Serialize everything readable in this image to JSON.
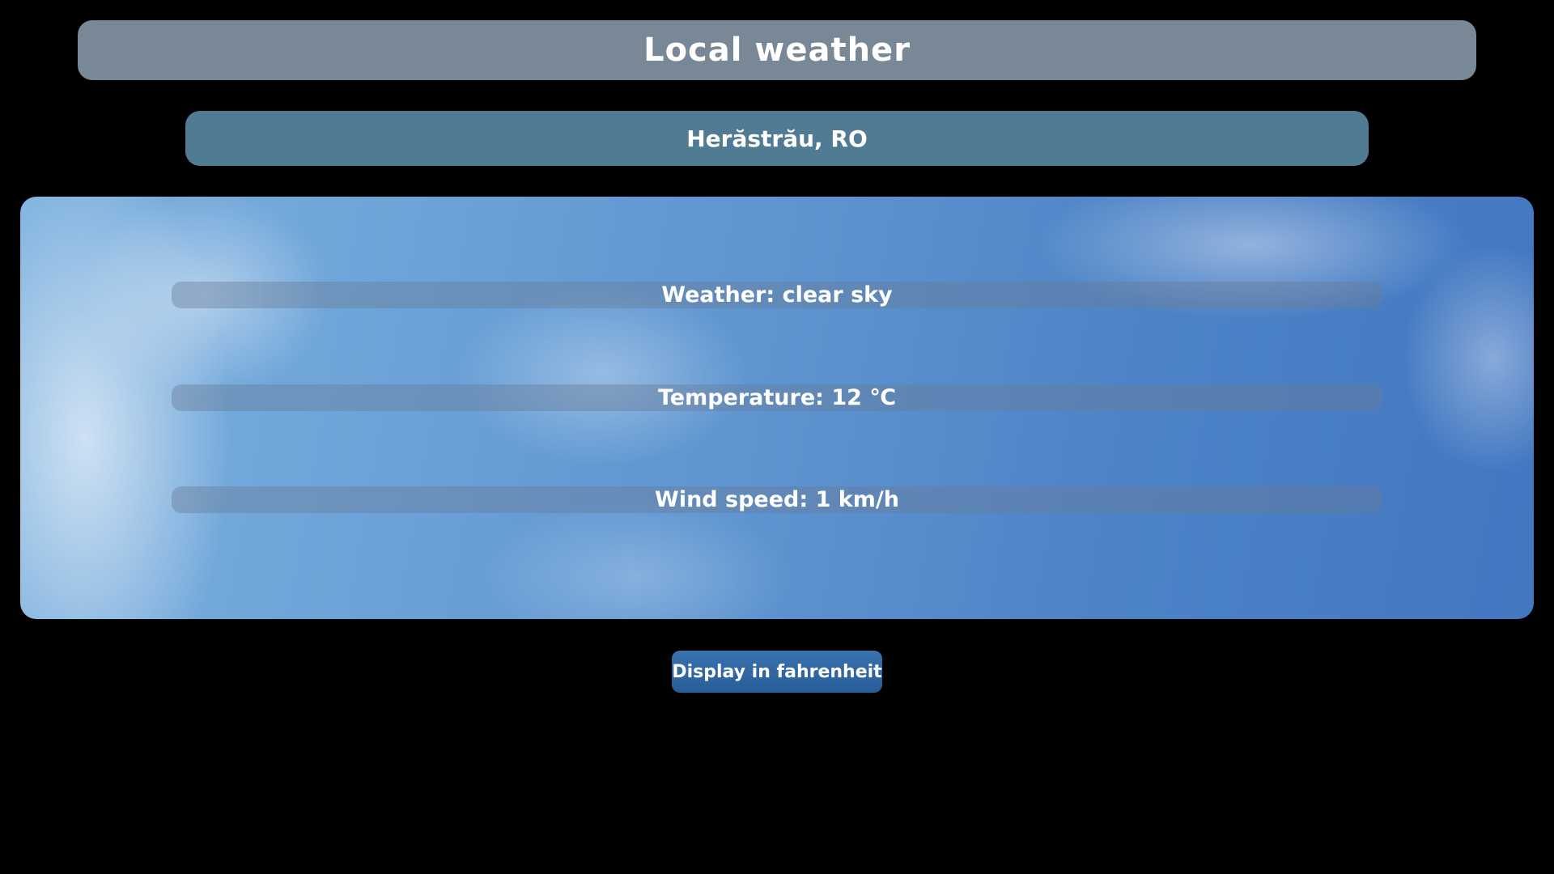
{
  "header": {
    "title": "Local weather"
  },
  "location": {
    "label": "Herăstrău, RO"
  },
  "weather": {
    "condition_text": "Weather: clear sky",
    "temperature_text": "Temperature: 12 ℃",
    "wind_text": "Wind speed: 1 km/h"
  },
  "controls": {
    "unit_toggle_label": "Display in fahrenheit"
  },
  "colors": {
    "background": "#000000",
    "title_bar": "#798896",
    "location_bar": "#517b93",
    "button": "#2f6aa6",
    "text": "#ffffff"
  }
}
